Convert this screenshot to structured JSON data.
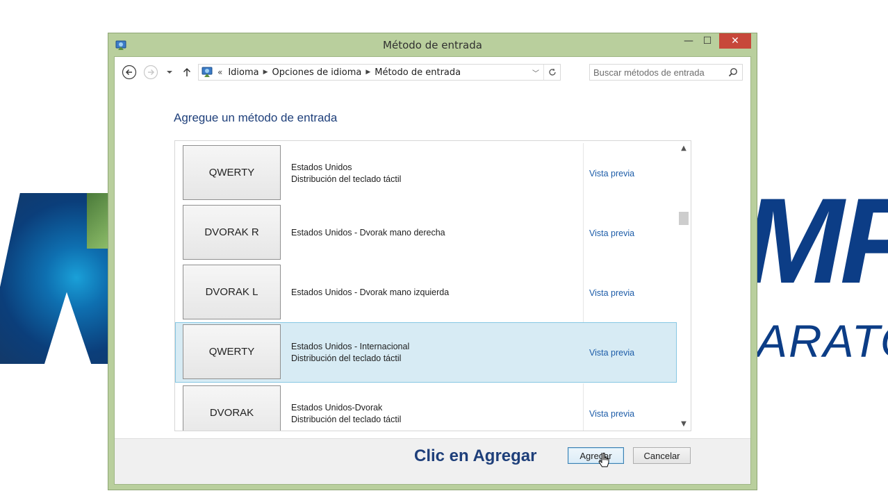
{
  "window": {
    "title": "Método de entrada",
    "minimize": "—",
    "maximize": "☐",
    "close": "✕"
  },
  "navigation": {
    "laquo": "«",
    "breadcrumb": [
      "Idioma",
      "Opciones de idioma",
      "Método de entrada"
    ],
    "search_placeholder": "Buscar métodos de entrada"
  },
  "main": {
    "heading": "Agregue un método de entrada",
    "methods": [
      {
        "layout": "QWERTY",
        "line1": "Estados Unidos",
        "line2": "Distribución del teclado táctil",
        "preview": "Vista previa",
        "selected": false
      },
      {
        "layout": "DVORAK R",
        "line1": "Estados Unidos - Dvorak mano derecha",
        "line2": "",
        "preview": "Vista previa",
        "selected": false
      },
      {
        "layout": "DVORAK L",
        "line1": "Estados Unidos - Dvorak mano izquierda",
        "line2": "",
        "preview": "Vista previa",
        "selected": false
      },
      {
        "layout": "QWERTY",
        "line1": "Estados Unidos - Internacional",
        "line2": "Distribución del teclado táctil",
        "preview": "Vista previa",
        "selected": true
      },
      {
        "layout": "DVORAK",
        "line1": "Estados Unidos-Dvorak",
        "line2": "Distribución del teclado táctil",
        "preview": "Vista previa",
        "selected": false
      }
    ]
  },
  "footer": {
    "caption": "Clic en Agregar",
    "add_label": "Agregar",
    "cancel_label": "Cancelar"
  },
  "background": {
    "logo_text_large": "MPU",
    "logo_text_small": "ARATO"
  },
  "colors": {
    "frame": "#b9cf9d",
    "accent_text": "#1e3f7a",
    "link": "#1c5ca8",
    "selection": "#d7ebf4",
    "close_button": "#c7483a"
  }
}
